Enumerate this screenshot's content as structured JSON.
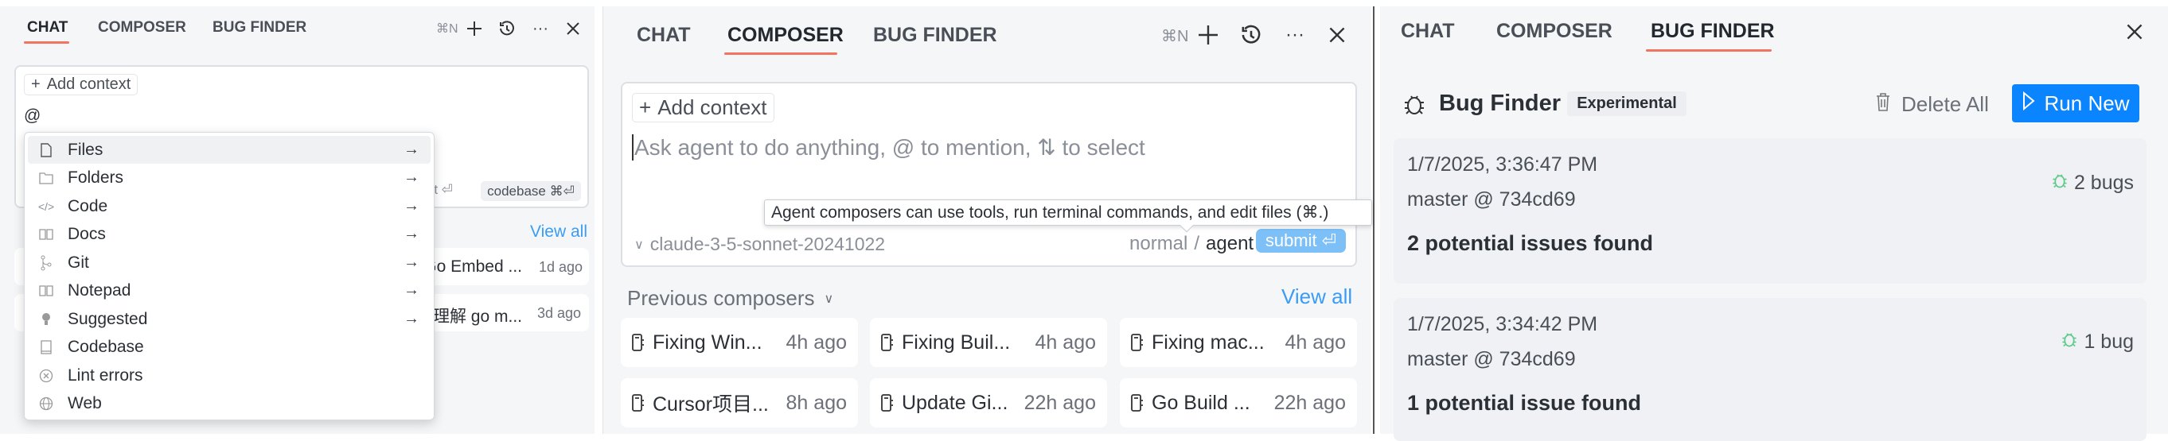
{
  "tabs": [
    "CHAT",
    "COMPOSER",
    "BUG FINDER"
  ],
  "header": {
    "new_shortcut": "⌘N"
  },
  "chat_panel": {
    "add_context": "Add context",
    "input_value": "@",
    "submit_fragment": "submit ⏎",
    "codebase_chip": "codebase ⌘⏎",
    "view_all": "View all",
    "menu_items": [
      {
        "label": "Files",
        "icon": "file-icon",
        "submenu": true
      },
      {
        "label": "Folders",
        "icon": "folder-icon",
        "submenu": true
      },
      {
        "label": "Code",
        "icon": "code-icon",
        "submenu": true
      },
      {
        "label": "Docs",
        "icon": "book-icon",
        "submenu": true
      },
      {
        "label": "Git",
        "icon": "git-icon",
        "submenu": true
      },
      {
        "label": "Notepad",
        "icon": "notepad-icon",
        "submenu": true
      },
      {
        "label": "Suggested",
        "icon": "lightbulb-icon",
        "submenu": true
      },
      {
        "label": "Codebase",
        "icon": "codebase-icon",
        "submenu": false
      },
      {
        "label": "Lint errors",
        "icon": "lint-icon",
        "submenu": false
      },
      {
        "label": "Web",
        "icon": "globe-icon",
        "submenu": false
      }
    ],
    "recent": [
      {
        "title": "Go Embed ...",
        "time": "1d ago"
      },
      {
        "title": "理解 go m...",
        "time": "3d ago"
      }
    ]
  },
  "composer_panel": {
    "add_context": "Add context",
    "placeholder": "Ask agent to do anything, @ to mention, ⇅ to select",
    "model": "claude-3-5-sonnet-20241022",
    "mode_normal": "normal",
    "mode_sep": "/",
    "mode_agent": "agent",
    "submit": "submit ⏎",
    "tooltip": "Agent composers can use tools, run terminal commands, and edit files (⌘.)",
    "previous_label": "Previous composers",
    "view_all": "View all",
    "cards": [
      {
        "title": "Fixing Win...",
        "time": "4h ago"
      },
      {
        "title": "Fixing Buil...",
        "time": "4h ago"
      },
      {
        "title": "Fixing mac...",
        "time": "4h ago"
      },
      {
        "title": "Cursor项目...",
        "time": "8h ago"
      },
      {
        "title": "Update Gi...",
        "time": "22h ago"
      },
      {
        "title": "Go Build ...",
        "time": "22h ago"
      }
    ]
  },
  "bug_panel": {
    "title": "Bug Finder",
    "badge": "Experimental",
    "delete_all": "Delete All",
    "run_new": "Run New",
    "runs": [
      {
        "date": "1/7/2025, 3:36:47 PM",
        "branch": "master @ 734cd69",
        "bugs": "2 bugs",
        "summary": "2 potential issues found"
      },
      {
        "date": "1/7/2025, 3:34:42 PM",
        "branch": "master @ 734cd69",
        "bugs": "1 bug",
        "summary": "1 potential issue found"
      }
    ]
  },
  "colors": {
    "accent_underline": "#f2735e",
    "link": "#3b9cf5",
    "run_button": "#0a84ff",
    "submit_button": "#7cc0f7",
    "bug_green": "#5cc98a"
  }
}
